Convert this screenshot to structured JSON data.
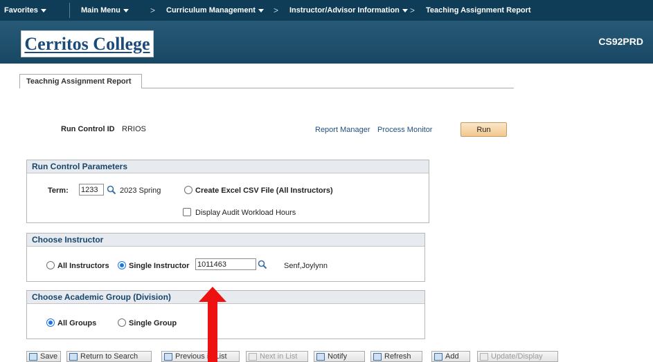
{
  "nav": {
    "favorites": "Favorites",
    "main_menu": "Main Menu",
    "separator": ">",
    "curriculum": "Curriculum Management",
    "instructor_info": "Instructor/Advisor Information",
    "current_page": "Teaching Assignment Report"
  },
  "header": {
    "logo": "Cerritos College",
    "database": "CS92PRD"
  },
  "tab": {
    "label": "Teachnig Assignment Report"
  },
  "run_control": {
    "label": "Run Control ID",
    "value": "RRIOS",
    "report_manager": "Report Manager",
    "process_monitor": "Process Monitor",
    "run_label": "Run"
  },
  "params": {
    "title": "Run Control Parameters",
    "term_label": "Term:",
    "term_value": "1233",
    "term_desc": "2023 Spring",
    "csv_label": "Create Excel CSV File (All Instructors)",
    "csv_selected": false,
    "audit_label": "Display Audit Workload Hours",
    "audit_checked": false
  },
  "instructor": {
    "title": "Choose Instructor",
    "all_label": "All Instructors",
    "single_label": "Single Instructor",
    "selected": "single",
    "id_value": "1011463",
    "name": "Senf,Joylynn"
  },
  "group": {
    "title": "Choose Academic Group (Division)",
    "all_label": "All Groups",
    "single_label": "Single Group",
    "selected": "all"
  },
  "toolbar": {
    "save": "Save",
    "return_to_search": "Return to Search",
    "previous_in_list": "Previous in List",
    "next_in_list": "Next in List",
    "notify": "Notify",
    "refresh": "Refresh",
    "add": "Add",
    "update_display": "Update/Display"
  },
  "colors": {
    "nav_bg": "#0f3d57",
    "header_bg": "#275a77",
    "link": "#1f4f83",
    "section_title": "#17466c",
    "run_button": "#f2c98f",
    "annotation_arrow": "#ee1111"
  },
  "icons": {
    "lookup": "magnifier-icon",
    "save": "floppy-icon",
    "return": "search-back-icon",
    "refresh": "refresh-icon"
  }
}
